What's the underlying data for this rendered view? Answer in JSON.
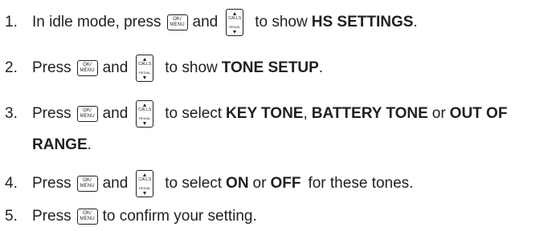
{
  "steps": [
    {
      "number": "1.",
      "text_before": "In idle mode, press",
      "and": "and",
      "text_after": "to show",
      "bold": "HS SETTINGS",
      "tail": "."
    },
    {
      "number": "2.",
      "text_before": "Press",
      "and": "and",
      "text_after": "to show",
      "bold": "TONE SETUP",
      "tail": "."
    },
    {
      "number": "3.",
      "text_before": "Press",
      "and": "and",
      "text_after": "to select",
      "bold1": "KEY TONE",
      "sep1": ",",
      "bold2": "BATTERY TONE",
      "sep2": "or",
      "bold3": "OUT OF",
      "line2_bold": "RANGE",
      "line2_tail": "."
    },
    {
      "number": "4.",
      "text_before": "Press",
      "and": "and",
      "text_after": "to select",
      "bold1": "ON",
      "sep1": "or",
      "bold2": "OFF",
      "tail": "for these tones."
    },
    {
      "number": "5.",
      "text_before": "Press",
      "text_after": "to confirm your setting."
    }
  ],
  "keys": {
    "menu_line1": "OK/",
    "menu_line2": "MENU",
    "calls_line1": "CALLS",
    "calls_line2": "REDIAL",
    "menu_icon": "ok-menu-key-icon",
    "calls_icon": "calls-redial-key-icon"
  }
}
